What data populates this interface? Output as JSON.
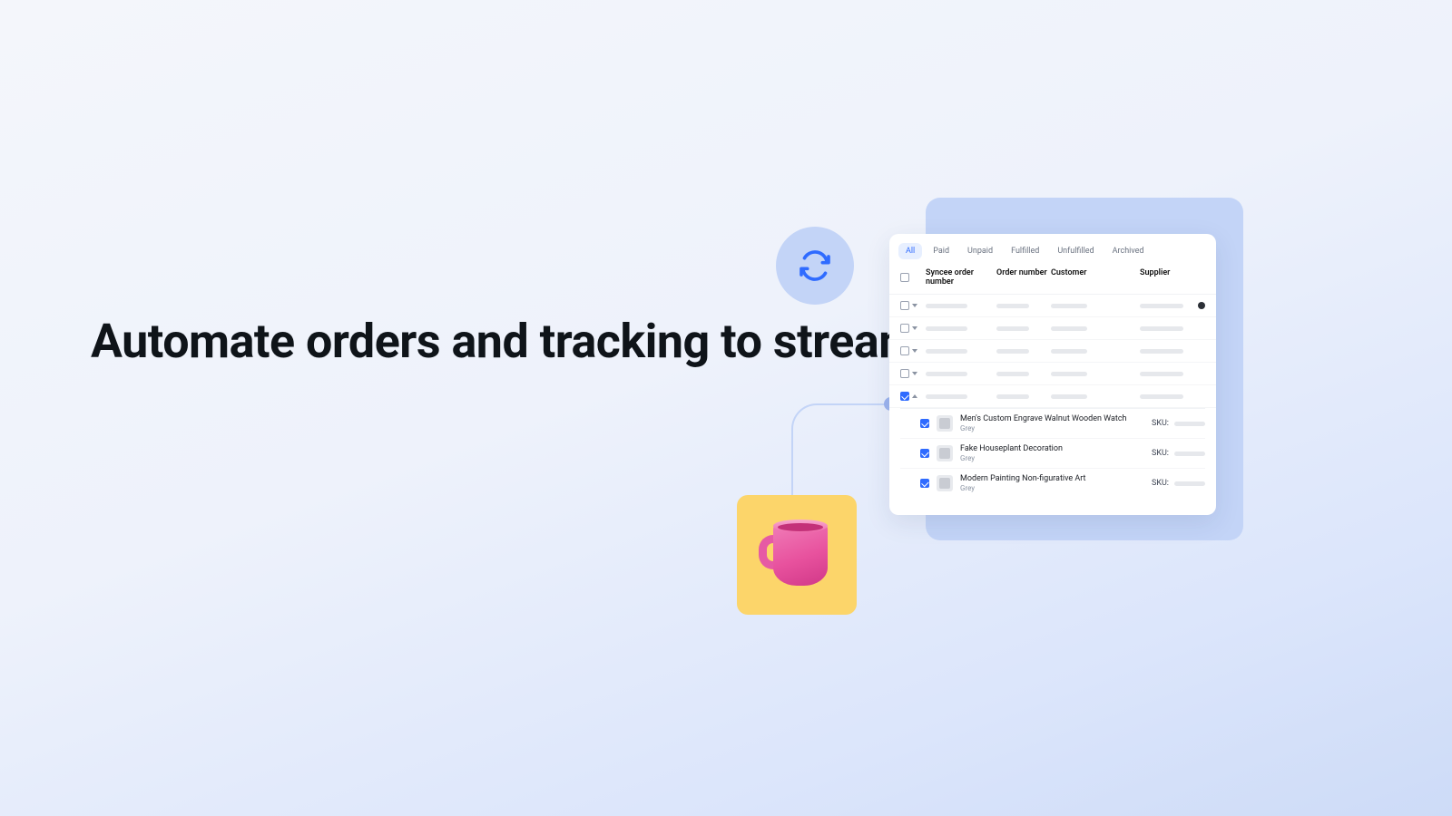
{
  "headline": "Automate orders and tracking to streamline workflows",
  "icons": {
    "sync": "sync-icon",
    "product": "mug"
  },
  "panel": {
    "tabs": [
      "All",
      "Paid",
      "Unpaid",
      "Fulfilled",
      "Unfulfilled",
      "Archived"
    ],
    "active_tab": "All",
    "columns": {
      "syncee": "Syncee order number",
      "order": "Order number",
      "customer": "Customer",
      "supplier": "Supplier"
    },
    "rows": [
      {
        "checked": false,
        "expanded": false,
        "status_dot": true
      },
      {
        "checked": false,
        "expanded": false
      },
      {
        "checked": false,
        "expanded": false
      },
      {
        "checked": false,
        "expanded": false
      },
      {
        "checked": true,
        "expanded": true
      }
    ],
    "sku_label": "SKU:",
    "line_items": [
      {
        "title": "Men's Custom Engrave Walnut Wooden Watch",
        "variant": "Grey"
      },
      {
        "title": "Fake Houseplant Decoration",
        "variant": "Grey"
      },
      {
        "title": "Modern Painting Non-figurative Art",
        "variant": "Grey"
      }
    ]
  }
}
